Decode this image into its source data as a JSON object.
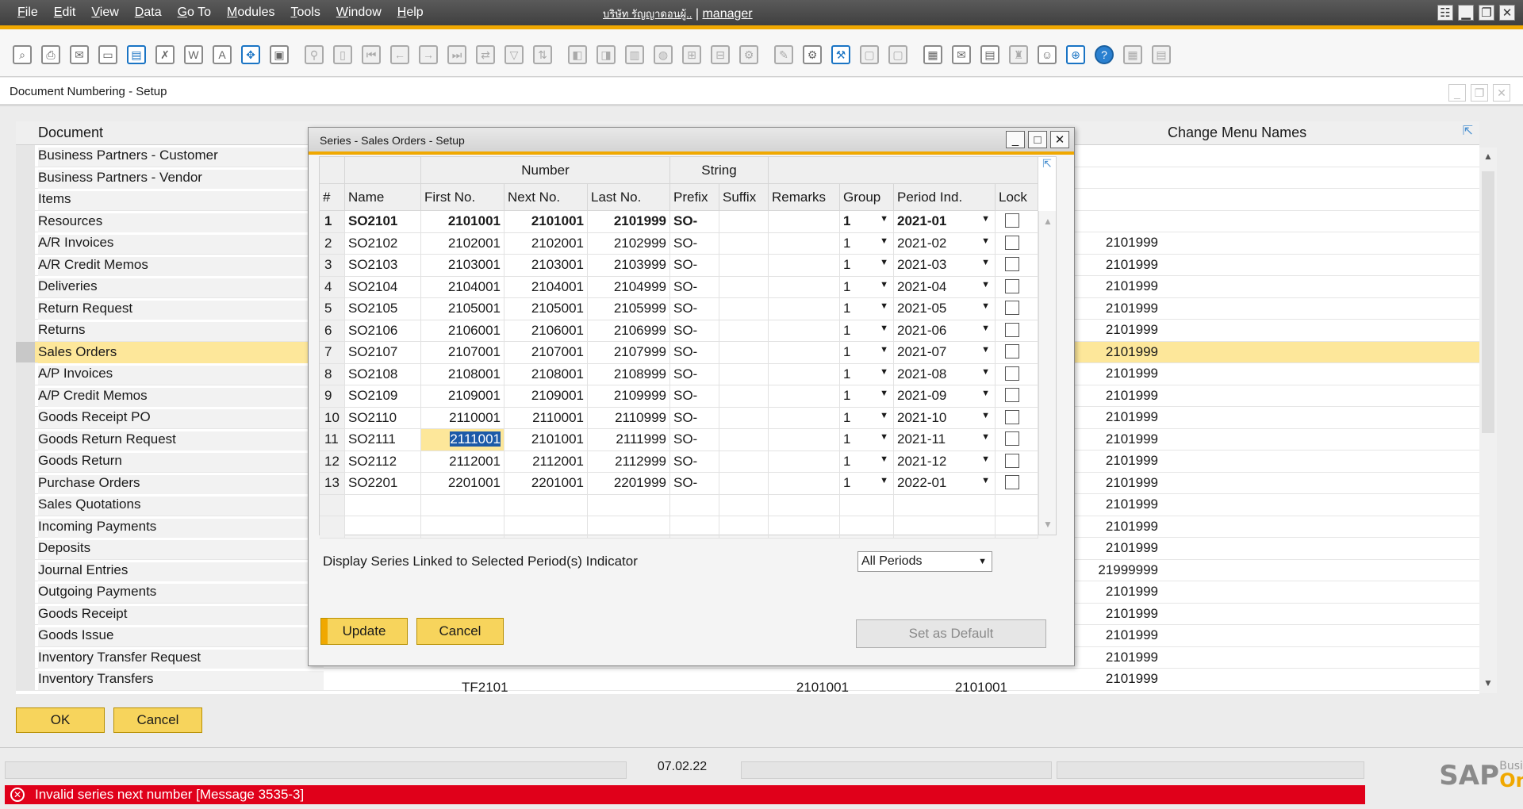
{
  "menubar": {
    "items": [
      "File",
      "Edit",
      "View",
      "Data",
      "Go To",
      "Modules",
      "Tools",
      "Window",
      "Help"
    ],
    "company": "บริษัท รัญญาดอนผู้..",
    "user": "manager"
  },
  "main_window": {
    "title": "Document Numbering - Setup",
    "col_document": "Document",
    "col_change_menu": "Change Menu Names",
    "documents": [
      {
        "name": "Business Partners - Customer",
        "value": ""
      },
      {
        "name": "Business Partners - Vendor",
        "value": ""
      },
      {
        "name": "Items",
        "value": ""
      },
      {
        "name": "Resources",
        "value": ""
      },
      {
        "name": "A/R Invoices",
        "value": "2101999"
      },
      {
        "name": "A/R Credit Memos",
        "value": "2101999"
      },
      {
        "name": "Deliveries",
        "value": "2101999"
      },
      {
        "name": "Return Request",
        "value": "2101999"
      },
      {
        "name": "Returns",
        "value": "2101999"
      },
      {
        "name": "Sales Orders",
        "value": "2101999"
      },
      {
        "name": "A/P Invoices",
        "value": "2101999"
      },
      {
        "name": "A/P Credit Memos",
        "value": "2101999"
      },
      {
        "name": "Goods Receipt PO",
        "value": "2101999"
      },
      {
        "name": "Goods Return Request",
        "value": "2101999"
      },
      {
        "name": "Goods Return",
        "value": "2101999"
      },
      {
        "name": "Purchase Orders",
        "value": "2101999"
      },
      {
        "name": "Sales Quotations",
        "value": "2101999"
      },
      {
        "name": "Incoming Payments",
        "value": "2101999"
      },
      {
        "name": "Deposits",
        "value": "2101999"
      },
      {
        "name": "Journal Entries",
        "value": "21999999"
      },
      {
        "name": "Outgoing Payments",
        "value": "2101999"
      },
      {
        "name": "Goods Receipt",
        "value": "2101999"
      },
      {
        "name": "Goods Issue",
        "value": "2101999"
      },
      {
        "name": "Inventory Transfer Request",
        "value": "2101999"
      },
      {
        "name": "Inventory Transfers",
        "value": "2101999"
      }
    ],
    "last_row_series": "TF2101",
    "last_row_first": "2101001",
    "last_row_next": "2101001",
    "ok_label": "OK",
    "cancel_label": "Cancel"
  },
  "dialog": {
    "title": "Series - Sales Orders - Setup",
    "group_number": "Number",
    "group_string": "String",
    "columns": [
      "#",
      "Name",
      "First No.",
      "Next No.",
      "Last No.",
      "Prefix",
      "Suffix",
      "Remarks",
      "Group",
      "Period Ind.",
      "Lock"
    ],
    "rows": [
      {
        "n": "1",
        "name": "SO2101",
        "first": "2101001",
        "next": "2101001",
        "last": "2101999",
        "prefix": "SO-",
        "group": "1",
        "period": "2021-01"
      },
      {
        "n": "2",
        "name": "SO2102",
        "first": "2102001",
        "next": "2102001",
        "last": "2102999",
        "prefix": "SO-",
        "group": "1",
        "period": "2021-02"
      },
      {
        "n": "3",
        "name": "SO2103",
        "first": "2103001",
        "next": "2103001",
        "last": "2103999",
        "prefix": "SO-",
        "group": "1",
        "period": "2021-03"
      },
      {
        "n": "4",
        "name": "SO2104",
        "first": "2104001",
        "next": "2104001",
        "last": "2104999",
        "prefix": "SO-",
        "group": "1",
        "period": "2021-04"
      },
      {
        "n": "5",
        "name": "SO2105",
        "first": "2105001",
        "next": "2105001",
        "last": "2105999",
        "prefix": "SO-",
        "group": "1",
        "period": "2021-05"
      },
      {
        "n": "6",
        "name": "SO2106",
        "first": "2106001",
        "next": "2106001",
        "last": "2106999",
        "prefix": "SO-",
        "group": "1",
        "period": "2021-06"
      },
      {
        "n": "7",
        "name": "SO2107",
        "first": "2107001",
        "next": "2107001",
        "last": "2107999",
        "prefix": "SO-",
        "group": "1",
        "period": "2021-07"
      },
      {
        "n": "8",
        "name": "SO2108",
        "first": "2108001",
        "next": "2108001",
        "last": "2108999",
        "prefix": "SO-",
        "group": "1",
        "period": "2021-08"
      },
      {
        "n": "9",
        "name": "SO2109",
        "first": "2109001",
        "next": "2109001",
        "last": "2109999",
        "prefix": "SO-",
        "group": "1",
        "period": "2021-09"
      },
      {
        "n": "10",
        "name": "SO2110",
        "first": "2110001",
        "next": "2110001",
        "last": "2110999",
        "prefix": "SO-",
        "group": "1",
        "period": "2021-10"
      },
      {
        "n": "11",
        "name": "SO2111",
        "first": "2111001",
        "next": "2101001",
        "last": "2111999",
        "prefix": "SO-",
        "group": "1",
        "period": "2021-11"
      },
      {
        "n": "12",
        "name": "SO2112",
        "first": "2112001",
        "next": "2112001",
        "last": "2112999",
        "prefix": "SO-",
        "group": "1",
        "period": "2021-12"
      },
      {
        "n": "13",
        "name": "SO2201",
        "first": "2201001",
        "next": "2201001",
        "last": "2201999",
        "prefix": "SO-",
        "group": "1",
        "period": "2022-01"
      }
    ],
    "display_label": "Display Series Linked to Selected Period(s) Indicator",
    "period_filter": "All Periods",
    "update_label": "Update",
    "cancel_label": "Cancel",
    "set_default_label": "Set as Default"
  },
  "statusbar": {
    "date": "07.02.22",
    "error_message": "Invalid series next number  [Message 3535-3]",
    "logo_main": "SAP",
    "logo_business": "Business",
    "logo_one": "One"
  },
  "colors": {
    "accent": "#f0a800",
    "selection": "#fde79a",
    "error": "#e0001a",
    "button": "#f7d45c"
  }
}
